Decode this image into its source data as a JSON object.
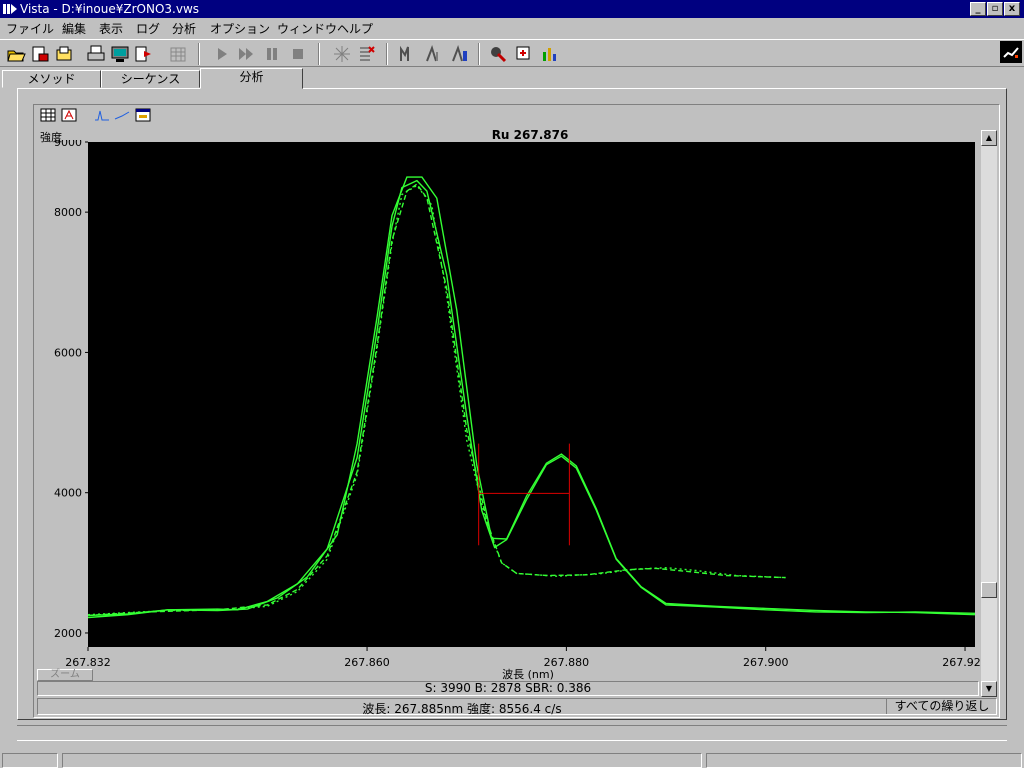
{
  "window": {
    "title": "Vista - D:¥inoue¥ZrONO3.vws",
    "min": "_",
    "max": "▫",
    "close": "x"
  },
  "menu": [
    "ファイル",
    "編集",
    "表示",
    "ログ",
    "分析",
    "オプション",
    "ウィンドウ",
    "ヘルプ"
  ],
  "toolbar_icons": [
    "open-icon",
    "save-icon",
    "save-as-icon",
    "print-icon",
    "monitor-icon",
    "export-icon",
    "grid-icon",
    "play-icon",
    "fast-forward-icon",
    "pause-icon",
    "stop-icon",
    "sparkle-icon",
    "sequence-icon",
    "wave-icon",
    "peak-icon",
    "flask-icon",
    "tools-icon",
    "calibrate-icon",
    "chart-bars-icon"
  ],
  "tabs": [
    {
      "label": "メソッド",
      "active": false
    },
    {
      "label": "シーケンス",
      "active": false
    },
    {
      "label": "分析",
      "active": true
    }
  ],
  "chart_toolbar": [
    "table-icon",
    "pdf-icon",
    "spectrum-icon",
    "line-icon",
    "window-icon"
  ],
  "chart_data": {
    "type": "line",
    "title": "Ru  267.876",
    "ylabel": "強度",
    "xlabel": "波長 (nm)",
    "xlim": [
      267.832,
      267.921
    ],
    "ylim": [
      1800,
      9000
    ],
    "x_ticks": [
      "267.832",
      "267.860",
      "267.880",
      "267.900",
      "267.920"
    ],
    "x_tick_values": [
      267.832,
      267.86,
      267.88,
      267.9,
      267.92
    ],
    "y_ticks": [
      "2000",
      "4000",
      "6000",
      "8000",
      "9000"
    ],
    "y_tick_values": [
      2000,
      4000,
      6000,
      8000,
      9000
    ],
    "background": "#000000",
    "line_color": "#33ff33",
    "marker_color": "#dd0000",
    "series": [
      {
        "style": "solid",
        "points": [
          [
            267.832,
            2250
          ],
          [
            267.836,
            2270
          ],
          [
            267.84,
            2330
          ],
          [
            267.845,
            2340
          ],
          [
            267.847,
            2330
          ],
          [
            267.85,
            2450
          ],
          [
            267.853,
            2700
          ],
          [
            267.856,
            3200
          ],
          [
            267.859,
            4500
          ],
          [
            267.861,
            6300
          ],
          [
            267.8625,
            7800
          ],
          [
            267.8635,
            8350
          ],
          [
            267.865,
            8450
          ],
          [
            267.866,
            8300
          ],
          [
            267.868,
            7100
          ],
          [
            267.87,
            5100
          ],
          [
            267.8715,
            3750
          ],
          [
            267.8728,
            3220
          ],
          [
            267.874,
            3330
          ],
          [
            267.876,
            3900
          ],
          [
            267.878,
            4400
          ],
          [
            267.8795,
            4520
          ],
          [
            267.881,
            4350
          ],
          [
            267.883,
            3750
          ],
          [
            267.885,
            3050
          ],
          [
            267.8875,
            2650
          ],
          [
            267.89,
            2400
          ],
          [
            267.895,
            2370
          ],
          [
            267.9,
            2330
          ],
          [
            267.905,
            2300
          ],
          [
            267.91,
            2290
          ],
          [
            267.915,
            2300
          ],
          [
            267.921,
            2280
          ]
        ]
      },
      {
        "style": "solid",
        "points": [
          [
            267.832,
            2220
          ],
          [
            267.836,
            2260
          ],
          [
            267.84,
            2330
          ],
          [
            267.845,
            2320
          ],
          [
            267.848,
            2340
          ],
          [
            267.851,
            2500
          ],
          [
            267.854,
            2800
          ],
          [
            267.857,
            3400
          ],
          [
            267.859,
            4700
          ],
          [
            267.861,
            6500
          ],
          [
            267.8625,
            7950
          ],
          [
            267.864,
            8500
          ],
          [
            267.8655,
            8500
          ],
          [
            267.867,
            8200
          ],
          [
            267.869,
            6600
          ],
          [
            267.871,
            4400
          ],
          [
            267.8725,
            3350
          ],
          [
            267.874,
            3340
          ],
          [
            267.876,
            3950
          ],
          [
            267.878,
            4420
          ],
          [
            267.8795,
            4550
          ],
          [
            267.881,
            4380
          ],
          [
            267.883,
            3770
          ],
          [
            267.885,
            3060
          ],
          [
            267.8875,
            2660
          ],
          [
            267.89,
            2420
          ],
          [
            267.895,
            2380
          ],
          [
            267.9,
            2350
          ],
          [
            267.905,
            2320
          ],
          [
            267.91,
            2300
          ],
          [
            267.915,
            2290
          ],
          [
            267.921,
            2260
          ]
        ]
      },
      {
        "style": "dashed",
        "points": [
          [
            267.832,
            2250
          ],
          [
            267.838,
            2300
          ],
          [
            267.845,
            2330
          ],
          [
            267.85,
            2400
          ],
          [
            267.853,
            2620
          ],
          [
            267.856,
            3100
          ],
          [
            267.859,
            4300
          ],
          [
            267.861,
            6100
          ],
          [
            267.8625,
            7600
          ],
          [
            267.864,
            8300
          ],
          [
            267.865,
            8400
          ],
          [
            267.866,
            8200
          ],
          [
            267.868,
            6900
          ],
          [
            267.87,
            4900
          ],
          [
            267.872,
            3600
          ],
          [
            267.8735,
            3000
          ],
          [
            267.875,
            2850
          ],
          [
            267.878,
            2820
          ],
          [
            267.882,
            2830
          ],
          [
            267.886,
            2900
          ],
          [
            267.889,
            2920
          ],
          [
            267.892,
            2880
          ],
          [
            267.896,
            2820
          ],
          [
            267.902,
            2790
          ]
        ]
      },
      {
        "style": "dotted",
        "points": [
          [
            267.832,
            2260
          ],
          [
            267.84,
            2320
          ],
          [
            267.846,
            2330
          ],
          [
            267.85,
            2380
          ],
          [
            267.853,
            2590
          ],
          [
            267.856,
            3050
          ],
          [
            267.859,
            4250
          ],
          [
            267.861,
            6050
          ],
          [
            267.8625,
            7550
          ],
          [
            267.8635,
            8250
          ],
          [
            267.865,
            8380
          ],
          [
            267.8665,
            8100
          ],
          [
            267.868,
            6800
          ],
          [
            267.87,
            4750
          ],
          [
            267.872,
            3550
          ],
          [
            267.8735,
            3000
          ],
          [
            267.875,
            2850
          ],
          [
            267.879,
            2810
          ],
          [
            267.883,
            2840
          ],
          [
            267.887,
            2910
          ],
          [
            267.89,
            2930
          ],
          [
            267.893,
            2890
          ],
          [
            267.897,
            2820
          ],
          [
            267.902,
            2790
          ]
        ]
      }
    ],
    "markers": {
      "left_x": 267.8712,
      "right_x": 267.8803,
      "top_y": 4700,
      "bottom_y": 3250,
      "mid_y": 3990
    }
  },
  "zoom_label": "ズーム",
  "sbr_text": "S: 3990  B: 2878  SBR: 0.386",
  "status": {
    "readout": "波長: 267.885nm  強度: 8556.4 c/s",
    "mode": "すべての繰り返し"
  }
}
